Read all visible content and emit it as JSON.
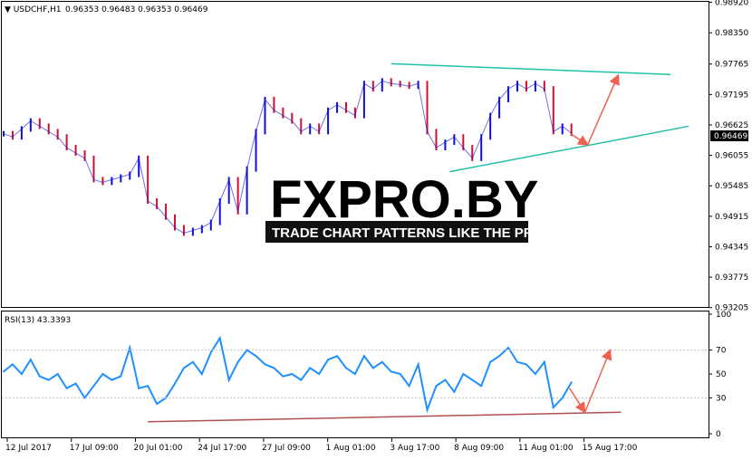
{
  "header": {
    "symbol": "USDCHF,H1",
    "ohlc": "0.96353 0.96483 0.96353 0.96469"
  },
  "watermark": {
    "brand": "FXPRO.BY",
    "tagline": "TRADE CHART PATTERNS LIKE THE PROS"
  },
  "colors": {
    "up_candle": "#1010d8",
    "down_candle": "#d01030",
    "rsi_line": "#1e90ff",
    "trend_line": "#20c0a8",
    "rsi_trend_line": "#b05050",
    "arrow": "#f06050"
  },
  "chart_data": [
    {
      "type": "line",
      "name": "price",
      "title": "USDCHF,H1",
      "ylim": [
        0.932,
        0.9893
      ],
      "y_ticks": [
        "0.98920",
        "0.98350",
        "0.97765",
        "0.97195",
        "0.96625",
        "0.96055",
        "0.95485",
        "0.94915",
        "0.94345",
        "0.93775",
        "0.93205"
      ],
      "current_price": "0.96469",
      "x_ticks": [
        "12 Jul 2017",
        "17 Jul 09:00",
        "20 Jul 01:00",
        "24 Jul 17:00",
        "27 Jul 09:00",
        "1 Aug 01:00",
        "3 Aug 17:00",
        "8 Aug 09:00",
        "11 Aug 01:00",
        "15 Aug 17:00"
      ],
      "x": [
        0,
        10,
        20,
        30,
        40,
        50,
        60,
        70,
        80,
        90,
        100,
        110,
        120,
        130,
        140,
        150,
        160,
        170,
        180,
        190,
        200,
        210,
        220,
        230,
        240,
        250,
        260,
        270,
        280,
        290,
        300,
        310,
        320,
        330,
        340,
        350,
        360,
        370,
        380,
        390,
        400,
        410,
        420,
        430,
        440,
        450,
        460,
        470,
        480,
        490,
        500,
        510,
        520,
        530,
        540,
        550,
        560,
        570,
        580,
        590,
        600,
        610,
        620,
        630
      ],
      "values": [
        0.9646,
        0.964,
        0.9655,
        0.967,
        0.966,
        0.965,
        0.964,
        0.962,
        0.961,
        0.96,
        0.956,
        0.9555,
        0.956,
        0.9565,
        0.957,
        0.96,
        0.952,
        0.951,
        0.949,
        0.947,
        0.946,
        0.9465,
        0.947,
        0.948,
        0.952,
        0.956,
        0.95,
        0.958,
        0.965,
        0.971,
        0.969,
        0.968,
        0.967,
        0.965,
        0.966,
        0.965,
        0.969,
        0.97,
        0.969,
        0.968,
        0.974,
        0.973,
        0.9745,
        0.974,
        0.9738,
        0.9735,
        0.974,
        0.965,
        0.962,
        0.963,
        0.964,
        0.962,
        0.96,
        0.964,
        0.968,
        0.971,
        0.973,
        0.974,
        0.973,
        0.974,
        0.973,
        0.965,
        0.966,
        0.9647
      ],
      "annotations": [
        {
          "kind": "trend_line",
          "points": [
            [
              430,
              0.9777
            ],
            [
              740,
              0.9757
            ]
          ]
        },
        {
          "kind": "trend_line",
          "points": [
            [
              495,
              0.9575
            ],
            [
              760,
              0.966
            ]
          ]
        },
        {
          "kind": "arrow",
          "points": [
            [
              630,
              0.9645
            ],
            [
              648,
              0.9625
            ]
          ]
        },
        {
          "kind": "arrow",
          "points": [
            [
              648,
              0.9625
            ],
            [
              682,
              0.9756
            ]
          ]
        }
      ]
    },
    {
      "type": "line",
      "name": "rsi",
      "title": "RSI(13) 43.3393",
      "ylim": [
        0,
        100
      ],
      "y_ticks": [
        "100",
        "70",
        "50",
        "30",
        "0"
      ],
      "x": [
        0,
        10,
        20,
        30,
        40,
        50,
        60,
        70,
        80,
        90,
        100,
        110,
        120,
        130,
        140,
        150,
        160,
        170,
        180,
        190,
        200,
        210,
        220,
        230,
        240,
        250,
        260,
        270,
        280,
        290,
        300,
        310,
        320,
        330,
        340,
        350,
        360,
        370,
        380,
        390,
        400,
        410,
        420,
        430,
        440,
        450,
        460,
        470,
        480,
        490,
        500,
        510,
        520,
        530,
        540,
        550,
        560,
        570,
        580,
        590,
        600,
        610,
        620,
        630
      ],
      "values": [
        52,
        58,
        50,
        62,
        48,
        45,
        50,
        38,
        42,
        30,
        40,
        50,
        45,
        48,
        72,
        38,
        40,
        25,
        30,
        42,
        55,
        60,
        50,
        68,
        80,
        45,
        60,
        70,
        65,
        58,
        55,
        48,
        50,
        45,
        55,
        50,
        62,
        65,
        55,
        50,
        65,
        55,
        60,
        52,
        50,
        40,
        58,
        20,
        40,
        45,
        35,
        50,
        45,
        40,
        60,
        65,
        72,
        60,
        58,
        50,
        60,
        22,
        30,
        43
      ],
      "annotations": [
        {
          "kind": "trend_line",
          "points": [
            [
              160,
              10
            ],
            [
              685,
              18
            ]
          ]
        },
        {
          "kind": "arrow",
          "points": [
            [
              628,
              38
            ],
            [
              645,
              18
            ]
          ]
        },
        {
          "kind": "arrow",
          "points": [
            [
              645,
              18
            ],
            [
              673,
              70
            ]
          ]
        }
      ]
    }
  ]
}
